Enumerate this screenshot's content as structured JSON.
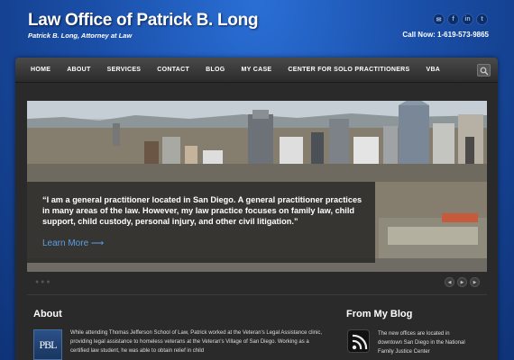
{
  "header": {
    "title": "Law Office of Patrick B. Long",
    "tagline": "Patrick B. Long, Attorney at Law",
    "phone": "Call Now: 1-619-573-9865",
    "social_icons": [
      "email-icon",
      "facebook-icon",
      "linkedin-icon",
      "twitter-icon"
    ]
  },
  "nav": {
    "items": [
      "HOME",
      "ABOUT",
      "SERVICES",
      "CONTACT",
      "BLOG",
      "MY CASE",
      "CENTER FOR SOLO PRACTITIONERS",
      "VBA"
    ],
    "search_icon": "search-icon"
  },
  "slider": {
    "quote": "“I am a general practitioner located in San Diego. A general practitioner practices in many areas of the law. However, my law practice focuses on family law, child support, child custody, personal injury, and other civil litigation.”",
    "learn_more": "Learn More ⟶"
  },
  "about": {
    "title": "About",
    "logo_text": "PBL",
    "text": "While attending Thomas Jefferson School of Law, Patrick worked at the Veteran's Legal Assistance clinic, providing legal assistance to homeless veterans at the Veteran's Village of San Diego. Working as a certified law student, he was able to obtain relief in child"
  },
  "blog": {
    "title": "From My Blog",
    "text": "The new offices are located in downtown San Diego in the National Family Justice Center"
  },
  "colors": {
    "background": "#1a4fa8",
    "accent": "#5a9ee8",
    "panel": "#2a2a2a"
  }
}
